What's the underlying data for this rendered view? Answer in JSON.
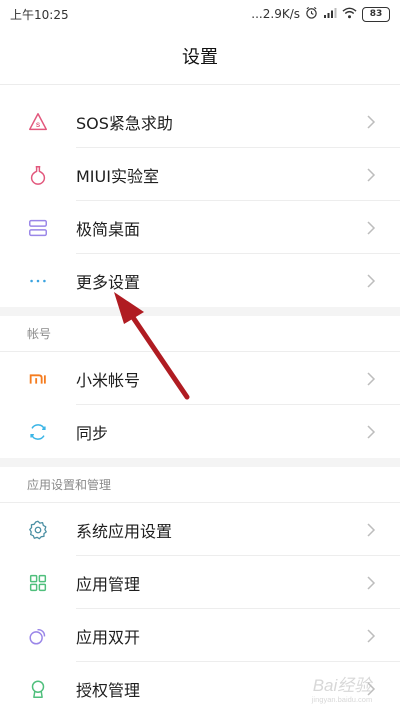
{
  "status_bar": {
    "time": "上午10:25",
    "network_speed": "...2.9K/s",
    "battery_level": "83"
  },
  "header": {
    "title": "设置"
  },
  "groups": [
    {
      "header": "",
      "items": [
        {
          "label": "SOS紧急求助",
          "icon": "sos-icon",
          "color": "#e2577c"
        },
        {
          "label": "MIUI实验室",
          "icon": "flask-icon",
          "color": "#e2577c"
        },
        {
          "label": "极简桌面",
          "icon": "desktop-layers-icon",
          "color": "#9a86e8"
        },
        {
          "label": "更多设置",
          "icon": "more-dots-icon",
          "color": "#3aa3e0"
        }
      ]
    },
    {
      "header": "帐号",
      "items": [
        {
          "label": "小米帐号",
          "icon": "mi-logo-icon",
          "color": "#f57c1f"
        },
        {
          "label": "同步",
          "icon": "sync-icon",
          "color": "#3ab5e6"
        }
      ]
    },
    {
      "header": "应用设置和管理",
      "items": [
        {
          "label": "系统应用设置",
          "icon": "gear-icon",
          "color": "#4a8fa3"
        },
        {
          "label": "应用管理",
          "icon": "app-grid-icon",
          "color": "#4fbf7c"
        },
        {
          "label": "应用双开",
          "icon": "dual-app-icon",
          "color": "#9a86e8"
        },
        {
          "label": "授权管理",
          "icon": "shield-ribbon-icon",
          "color": "#4fbf7c"
        }
      ]
    }
  ],
  "annotation": {
    "arrow_color": "#b01c22"
  },
  "watermark": {
    "text": "Bai经验",
    "subtext": "jingyan.baidu.com"
  }
}
